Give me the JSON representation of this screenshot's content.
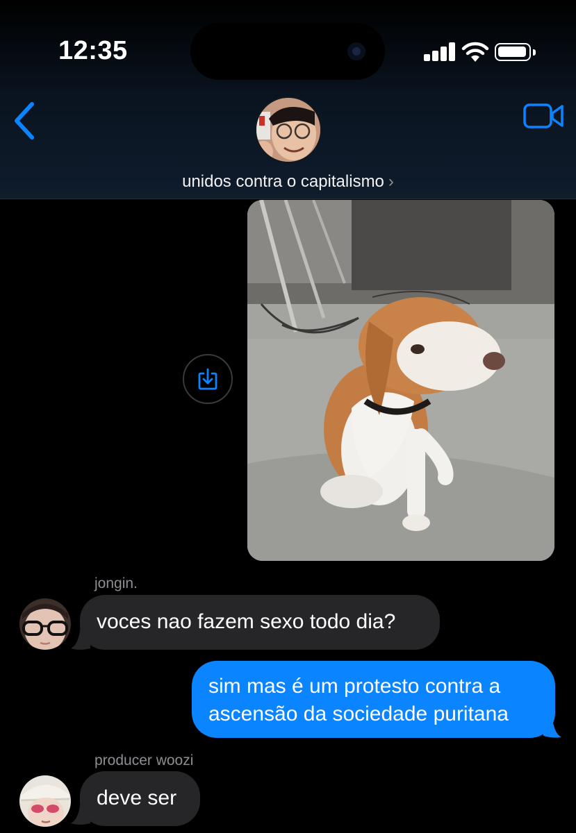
{
  "status_bar": {
    "time": "12:35",
    "icons": [
      "cellular-signal-icon",
      "wifi-icon",
      "battery-icon"
    ]
  },
  "header": {
    "back_icon": "chevron-left-icon",
    "video_icon": "video-camera-icon",
    "group_name": "unidos contra o capitalismo",
    "group_chevron": "›"
  },
  "messages": [
    {
      "type": "image",
      "from": "me",
      "description_icon": "dog-photo",
      "action_icon": "save-download-icon"
    },
    {
      "type": "text",
      "from": "jongin.",
      "sender_label": "jongin.",
      "text": "voces nao fazem sexo todo dia?"
    },
    {
      "type": "text",
      "from": "me",
      "lines": [
        "sim mas é um protesto contra a",
        "ascensão da sociedade puritana"
      ]
    },
    {
      "type": "text",
      "from": "producer woozi",
      "sender_label": "producer woozi",
      "text": "deve ser"
    }
  ],
  "colors": {
    "accent": "#0a84ff",
    "incoming_bubble": "#262628",
    "background": "#000000",
    "secondary_text": "#8e8e93"
  }
}
